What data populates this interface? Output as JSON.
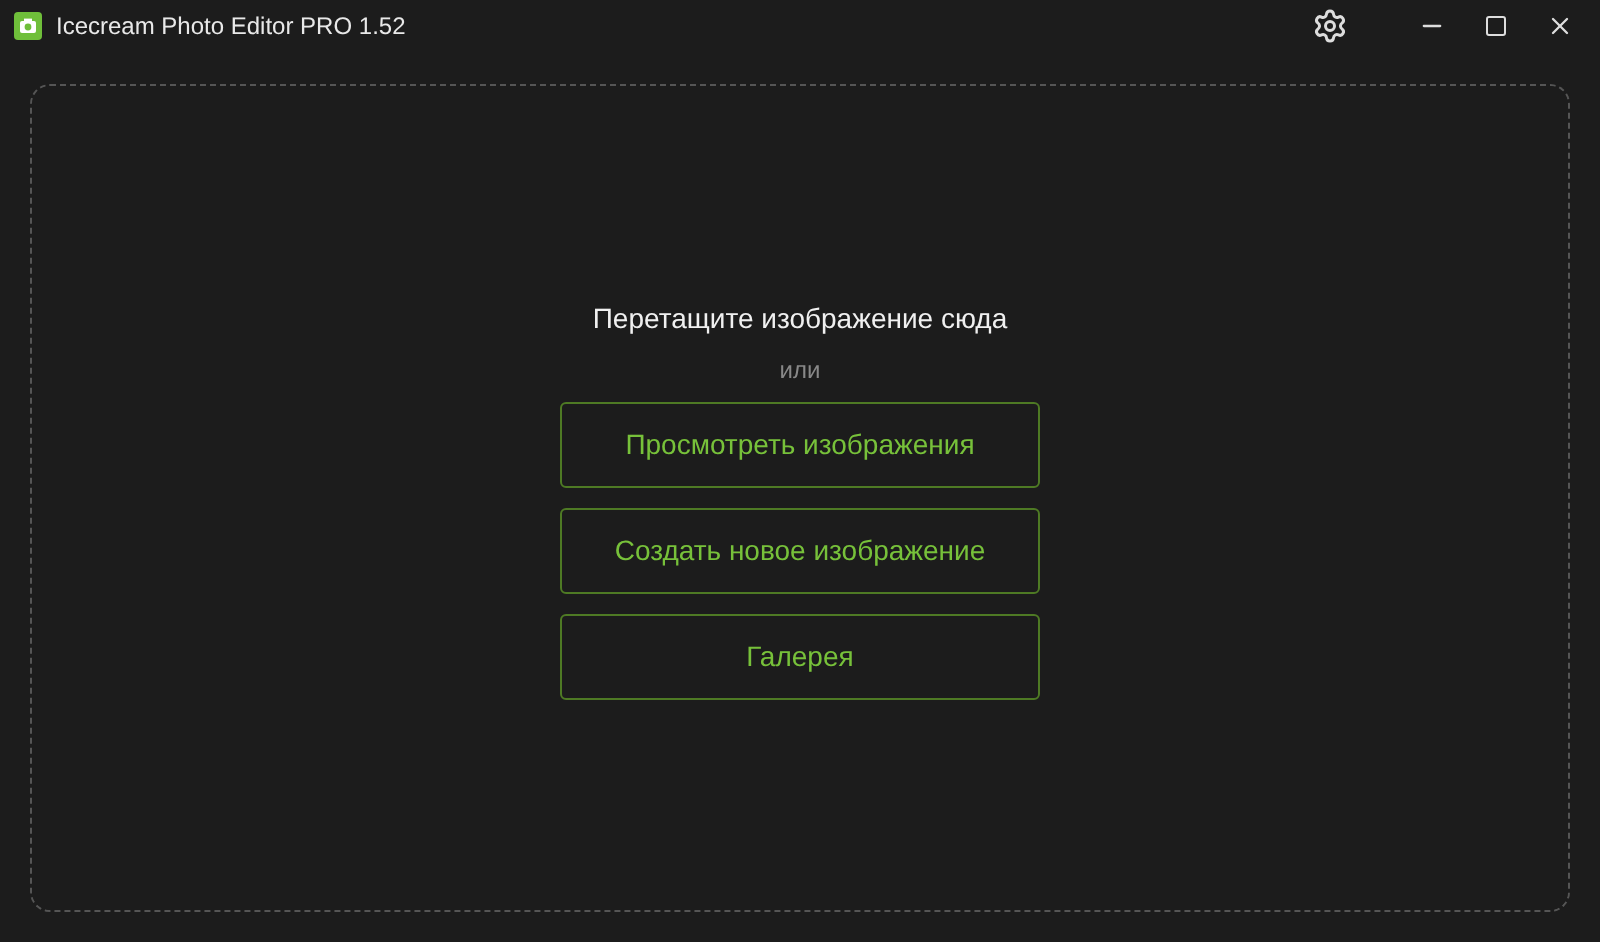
{
  "window": {
    "title": "Icecream Photo Editor PRO 1.52"
  },
  "drop_zone": {
    "prompt": "Перетащите изображение сюда",
    "separator": "или"
  },
  "buttons": [
    "Просмотреть изображения",
    "Создать новое изображение",
    "Галерея"
  ]
}
